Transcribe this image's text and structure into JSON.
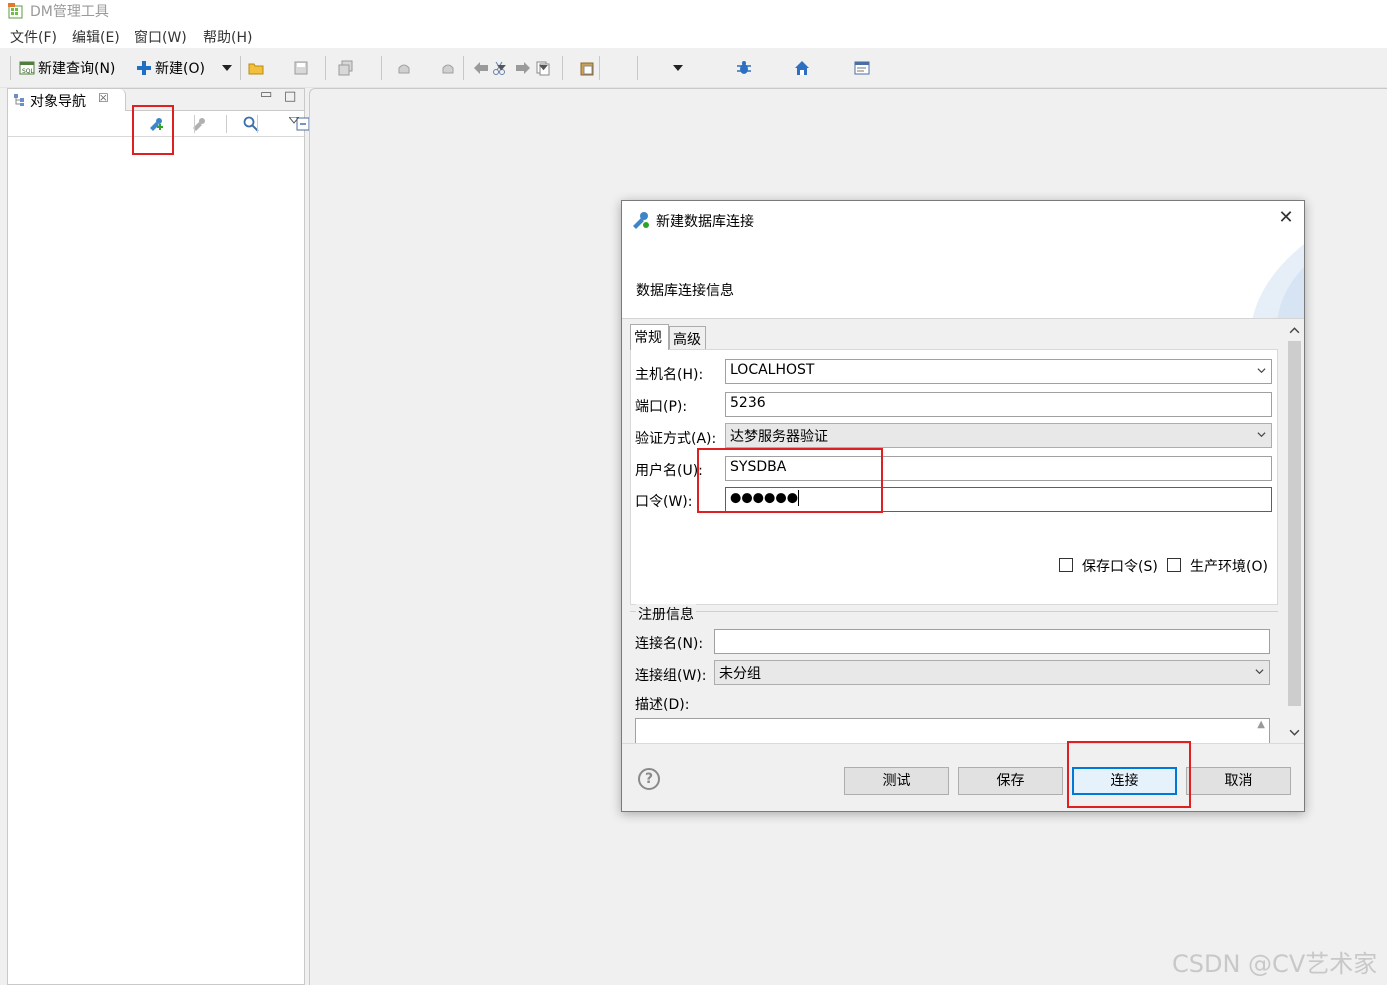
{
  "app": {
    "title": "DM管理工具"
  },
  "menu": [
    {
      "label": "文件(F)"
    },
    {
      "label": "编辑(E)"
    },
    {
      "label": "窗口(W)"
    },
    {
      "label": "帮助(H)"
    }
  ],
  "toolbar": {
    "new_query_label": "新建查询(N)",
    "new_label": "新建(O)"
  },
  "nav_panel": {
    "tab_label": "对象导航"
  },
  "dialog": {
    "title": "新建数据库连接",
    "subtitle": "数据库连接信息",
    "close": "✕",
    "tabs": [
      {
        "label": "常规",
        "active": true
      },
      {
        "label": "高级",
        "active": false
      }
    ],
    "general": {
      "host_label": "主机名(H):",
      "host_value": "LOCALHOST",
      "port_label": "端口(P):",
      "port_value": "5236",
      "auth_label": "验证方式(A):",
      "auth_value": "达梦服务器验证",
      "user_label": "用户名(U):",
      "user_value": "SYSDBA",
      "password_label": "口令(W):",
      "password_value": "●●●●●●",
      "save_password_label": "保存口令(S)",
      "production_label": "生产环境(O)"
    },
    "register": {
      "group_label": "注册信息",
      "conn_name_label": "连接名(N):",
      "conn_name_value": "",
      "conn_group_label": "连接组(W):",
      "conn_group_value": "未分组",
      "desc_label": "描述(D):"
    },
    "buttons": {
      "help": "?",
      "test": "测试",
      "save": "保存",
      "connect": "连接",
      "cancel": "取消"
    }
  },
  "watermark": "CSDN @CV艺术家",
  "colors": {
    "accent": "#0078d7",
    "annotation": "#e02020"
  }
}
